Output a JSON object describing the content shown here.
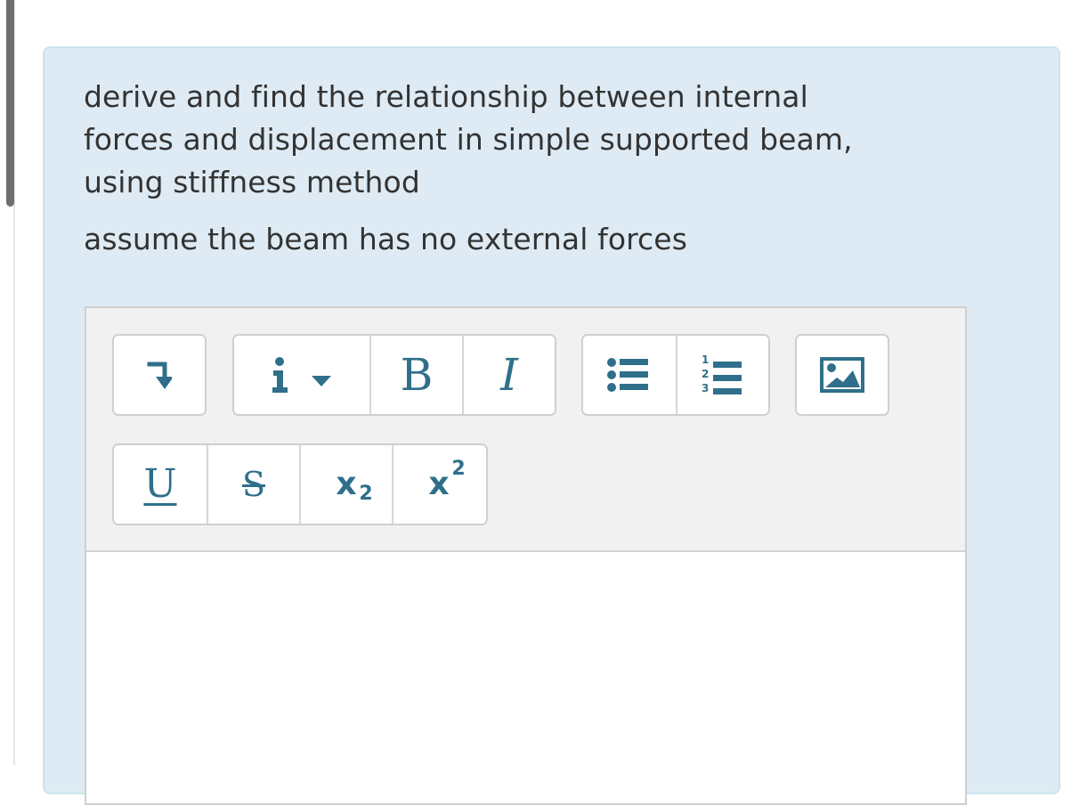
{
  "question": {
    "line_1": "derive and find the relationship between internal",
    "line_2": "forces and displacement in simple supported beam,",
    "line_3": "using stiffness method",
    "assumption": "assume the beam has no external forces"
  },
  "editor": {
    "toolbar": {
      "paragraph_format_icon": "paragraph-format-icon",
      "info_icon": "info-icon",
      "bold_label": "B",
      "italic_label": "I",
      "bulleted_list_icon": "bulleted-list-icon",
      "numbered_list_icon": "numbered-list-icon",
      "image_icon": "image-icon",
      "underline_label": "U",
      "strikethrough_label": "S",
      "subscript_base": "x",
      "subscript_mark": "2",
      "superscript_base": "x",
      "superscript_mark": "2"
    }
  },
  "colors": {
    "panel_background": "#deebf4",
    "panel_border": "#cde2ee",
    "question_text": "#333333",
    "toolbar_background": "#f1f1f1",
    "toolbar_icon": "#2f6f8a",
    "button_border": "#cfcfcf",
    "scrollbar_thumb": "#6f6f6f"
  }
}
